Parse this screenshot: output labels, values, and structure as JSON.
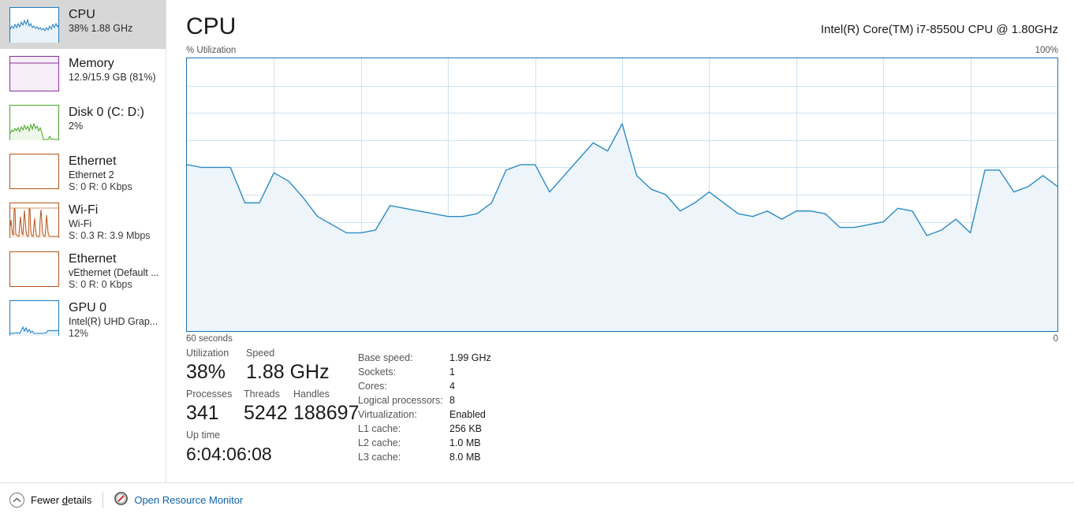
{
  "sidebar": {
    "items": [
      {
        "id": "cpu",
        "icon": "cpu-graph-icon",
        "title": "CPU",
        "sub": "38%  1.88 GHz",
        "sub2": "",
        "selected": true,
        "color": "#1a7cc0",
        "fill": "#eaf3fa"
      },
      {
        "id": "memory",
        "icon": "memory-graph-icon",
        "title": "Memory",
        "sub": "12.9/15.9 GB (81%)",
        "sub2": "",
        "selected": false,
        "color": "#8b30a0",
        "fill": "#f7eefa"
      },
      {
        "id": "disk0",
        "icon": "disk-graph-icon",
        "title": "Disk 0 (C: D:)",
        "sub": "2%",
        "sub2": "",
        "selected": false,
        "color": "#4aa62a",
        "fill": "#eef7e9"
      },
      {
        "id": "ethernet-2",
        "icon": "ethernet-graph-icon",
        "title": "Ethernet",
        "sub": "Ethernet 2",
        "sub2": "S: 0 R: 0 Kbps",
        "selected": false,
        "color": "#b5541b",
        "fill": "#fbf0e8"
      },
      {
        "id": "wifi",
        "icon": "wifi-graph-icon",
        "title": "Wi-Fi",
        "sub": "Wi-Fi",
        "sub2": "S: 0.3 R: 3.9 Mbps",
        "selected": false,
        "color": "#b5541b",
        "fill": "#fbf0e8"
      },
      {
        "id": "vethernet",
        "icon": "ethernet-graph-icon",
        "title": "Ethernet",
        "sub": "vEthernet (Default ...",
        "sub2": "S: 0 R: 0 Kbps",
        "selected": false,
        "color": "#b5541b",
        "fill": "#fbf0e8"
      },
      {
        "id": "gpu0",
        "icon": "gpu-graph-icon",
        "title": "GPU 0",
        "sub": "Intel(R) UHD Grap...",
        "sub2": "12%",
        "selected": false,
        "color": "#1a7cc0",
        "fill": "#eaf3fa"
      }
    ]
  },
  "main": {
    "title": "CPU",
    "device_name": "Intel(R) Core(TM) i7-8550U CPU @ 1.80GHz",
    "y_axis_label": "% Utilization",
    "y_axis_max": "100%",
    "y_axis_min": "0",
    "x_axis_label": "60 seconds"
  },
  "stats": {
    "utilization": {
      "label": "Utilization",
      "value": "38%"
    },
    "speed": {
      "label": "Speed",
      "value": "1.88 GHz"
    },
    "processes": {
      "label": "Processes",
      "value": "341"
    },
    "threads": {
      "label": "Threads",
      "value": "5242"
    },
    "handles": {
      "label": "Handles",
      "value": "188697"
    },
    "uptime": {
      "label": "Up time",
      "value": "6:04:06:08"
    },
    "specs": [
      {
        "key": "Base speed:",
        "value": "1.99 GHz"
      },
      {
        "key": "Sockets:",
        "value": "1"
      },
      {
        "key": "Cores:",
        "value": "4"
      },
      {
        "key": "Logical processors:",
        "value": "8"
      },
      {
        "key": "Virtualization:",
        "value": "Enabled"
      },
      {
        "key": "L1 cache:",
        "value": "256 KB"
      },
      {
        "key": "L2 cache:",
        "value": "1.0 MB"
      },
      {
        "key": "L3 cache:",
        "value": "8.0 MB"
      }
    ]
  },
  "footer": {
    "fewer_details_pre": "Fewer ",
    "fewer_details_accel": "d",
    "fewer_details_post": "etails",
    "resource_monitor": "Open Resource Monitor"
  },
  "colors": {
    "accent_line": "#2a8bc4",
    "accent_border": "#1f6fad",
    "graph_fill": "#eef5fa",
    "grid": "#cfe2ef",
    "link": "#0b63ad",
    "selected_row": "#d7d7d7"
  },
  "chart_data": {
    "type": "area",
    "title": "CPU % Utilization",
    "xlabel": "60 seconds",
    "ylabel": "% Utilization",
    "ylim": [
      0,
      100
    ],
    "xlim": [
      0,
      60
    ],
    "grid": true,
    "legend": "none",
    "line_color": "#2a8bc4",
    "fill_color": "#eef5fa",
    "x": [
      0,
      1,
      2,
      3,
      4,
      5,
      6,
      7,
      8,
      9,
      10,
      11,
      12,
      13,
      14,
      15,
      16,
      17,
      18,
      19,
      20,
      21,
      22,
      23,
      24,
      25,
      26,
      27,
      28,
      29,
      30,
      31,
      32,
      33,
      34,
      35,
      36,
      37,
      38,
      39,
      40,
      41,
      42,
      43,
      44,
      45,
      46,
      47,
      48,
      49,
      50,
      51,
      52,
      53,
      54,
      55,
      56,
      57,
      58,
      59,
      60
    ],
    "values": [
      61,
      60,
      60,
      60,
      47,
      47,
      58,
      55,
      49,
      42,
      39,
      36,
      36,
      37,
      46,
      45,
      44,
      43,
      42,
      42,
      43,
      47,
      59,
      61,
      61,
      51,
      57,
      63,
      69,
      66,
      76,
      57,
      52,
      50,
      44,
      47,
      51,
      47,
      43,
      42,
      44,
      41,
      44,
      44,
      43,
      38,
      38,
      39,
      40,
      45,
      44,
      35,
      37,
      41,
      36,
      59,
      59,
      51,
      53,
      57,
      53
    ]
  }
}
